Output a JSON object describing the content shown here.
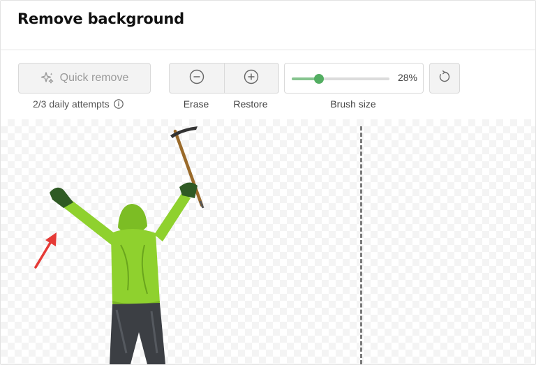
{
  "header": {
    "title": "Remove background"
  },
  "toolbar": {
    "quick_remove": {
      "label": "Quick remove",
      "icon": "sparkle-icon"
    },
    "attempts": {
      "text": "2/3 daily attempts",
      "icon": "info-icon"
    },
    "erase": {
      "label": "Erase",
      "icon": "minus-circle-icon"
    },
    "restore": {
      "label": "Restore",
      "icon": "plus-circle-icon"
    },
    "brush": {
      "label": "Brush size",
      "value_text": "28%",
      "value": 0.28
    },
    "reset": {
      "icon": "reset-icon"
    }
  },
  "colors": {
    "slider_fill": "#86c48f",
    "slider_thumb": "#53ae62",
    "annotation_arrow": "#e53935",
    "jacket": "#8fd12e"
  }
}
